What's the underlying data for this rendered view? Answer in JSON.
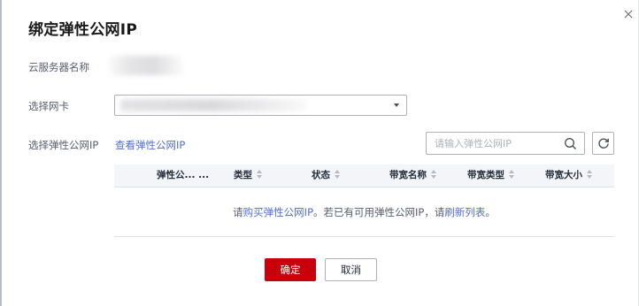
{
  "dialog": {
    "title": "绑定弹性公网IP"
  },
  "form": {
    "server_name_label": "云服务器名称",
    "nic_label": "选择网卡",
    "eip_label": "选择弹性公网IP",
    "view_eip_link": "查看弹性公网IP"
  },
  "search": {
    "placeholder": "请输入弹性公网IP"
  },
  "table": {
    "columns": [
      "弹性公...  ...",
      "类型",
      "状态",
      "带宽名称",
      "带宽类型",
      "带宽大小"
    ],
    "empty": {
      "prefix": "请",
      "buy_link": "购买弹性公网IP",
      "middle": "。若已有可用弹性公网IP，请",
      "refresh_link": "刷新列表",
      "suffix": "。"
    }
  },
  "footer": {
    "confirm_label": "确定",
    "cancel_label": "取消"
  },
  "colors": {
    "primary": "#c7000b",
    "link": "#526ecc",
    "border": "#adb0b8",
    "table_header_bg": "#f3f5f8"
  },
  "icons": [
    "close-icon",
    "search-icon",
    "refresh-icon",
    "caret-down-icon",
    "sort-icon"
  ]
}
